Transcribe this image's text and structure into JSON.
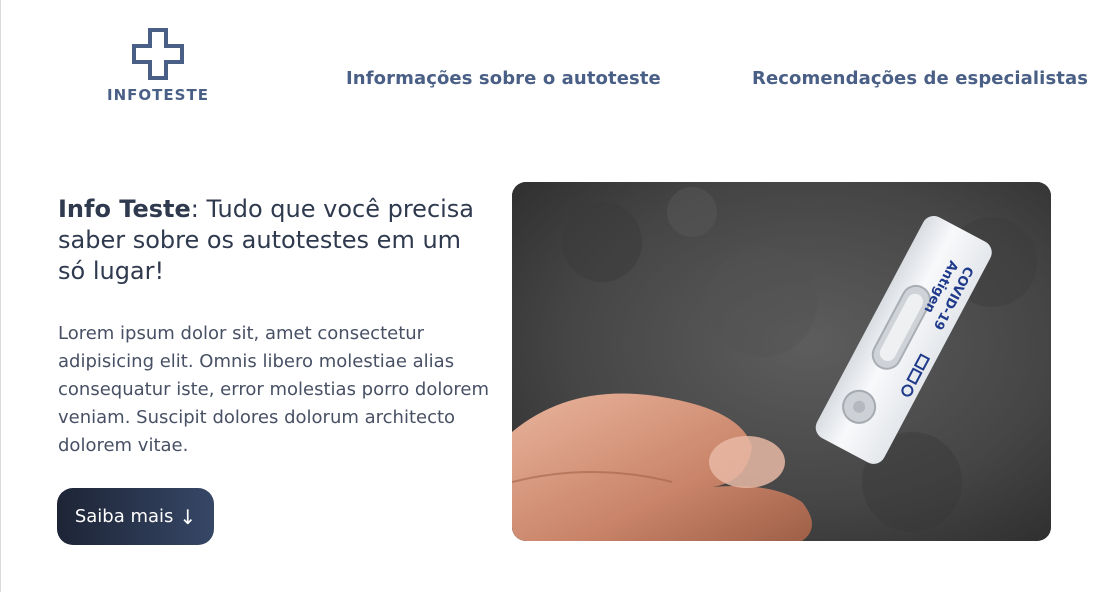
{
  "brand": {
    "name": "INFOTESTE",
    "icon": "medical-cross-icon",
    "color": "#4a5f85"
  },
  "nav": [
    {
      "label": "Informações sobre o autoteste"
    },
    {
      "label": "Recomendações de especialistas"
    }
  ],
  "hero": {
    "title_bold": "Info Teste",
    "title_rest": ": Tudo que você precisa saber sobre os autotestes em um só lugar!",
    "text": "Lorem ipsum dolor sit, amet consectetur adipisicing elit. Omnis libero molestiae alias consequatur iste, error molestias porro dolorem veniam. Suscipit dolores dolorum architecto dolorem vitae.",
    "cta_label": "Saiba mais",
    "cta_icon": "↓"
  },
  "image": {
    "subject": "covid-test-photo",
    "kit_line1": "COVID-19",
    "kit_line2": "Antigen"
  },
  "colors": {
    "text": "#2f3a4f",
    "nav": "#4a5f85",
    "button_start": "#1d2436",
    "button_end": "#364766"
  }
}
